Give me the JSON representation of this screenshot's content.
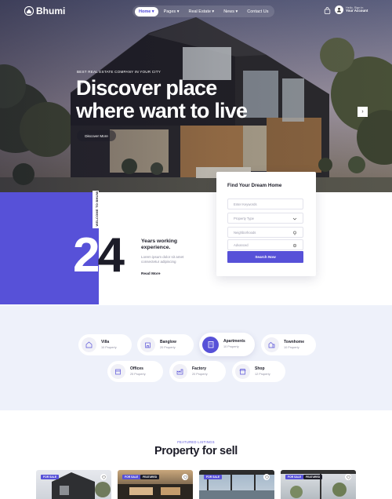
{
  "brand": {
    "name": "Bhumi"
  },
  "nav": {
    "items": [
      {
        "label": "Home ▾",
        "active": true
      },
      {
        "label": "Pages ▾",
        "active": false
      },
      {
        "label": "Real Estate ▾",
        "active": false
      },
      {
        "label": "News ▾",
        "active": false
      },
      {
        "label": "Contact Us",
        "active": false
      }
    ],
    "account_line1": "Hello, Sign in",
    "account_line2": "Your Account"
  },
  "hero": {
    "eyebrow": "BEST REAL ESTATE COMPANY IN YOUR CITY",
    "title": "Discover place where want to live",
    "button": "Discover More",
    "next_arrow": "›"
  },
  "stats": {
    "vertical_label": "WELCOME TO BHUMI",
    "number_digit1": "2",
    "number_digit2": "4",
    "headline": "Years working experience.",
    "description": "Lorem ipsum dolor sit amet consectetur adipiscing",
    "link": "Read More"
  },
  "search": {
    "title": "Find Your Dream Home",
    "keywords_placeholder": "Enter Keywords",
    "property_type": "Property Type",
    "neighborhoods": "Neighborhoods",
    "advanced": "Advanced",
    "button": "Search Now"
  },
  "categories": [
    {
      "name": "Villa",
      "count": "10 Property",
      "icon": "villa-icon",
      "active": false
    },
    {
      "name": "Banglow",
      "count": "20 Property",
      "icon": "banglow-icon",
      "active": false
    },
    {
      "name": "Apartments",
      "count": "10 Property",
      "icon": "apartment-icon",
      "active": true
    },
    {
      "name": "Townhome",
      "count": "10 Property",
      "icon": "townhome-icon",
      "active": false
    },
    {
      "name": "Offices",
      "count": "25 Property",
      "icon": "office-icon",
      "active": false
    },
    {
      "name": "Factory",
      "count": "20 Property",
      "icon": "factory-icon",
      "active": false
    },
    {
      "name": "Shop",
      "count": "12 Property",
      "icon": "shop-icon",
      "active": false
    }
  ],
  "listings": {
    "eyebrow": "FEATURED LISTINGS",
    "title": "Property for sell",
    "cards": [
      {
        "tags": [
          "FOR SALE"
        ]
      },
      {
        "tags": [
          "FOR SALE",
          "FEATURED"
        ]
      },
      {
        "tags": [
          "FOR SALE"
        ]
      },
      {
        "tags": [
          "FOR SALE",
          "FEATURED"
        ]
      }
    ]
  },
  "colors": {
    "accent": "#5751d8",
    "dark": "#1c1c28",
    "section_bg": "#eef1fa"
  }
}
